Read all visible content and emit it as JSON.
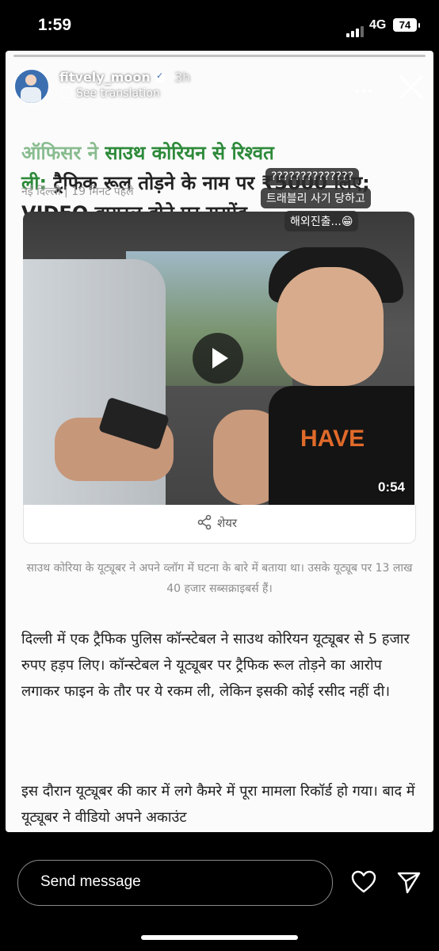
{
  "status_bar": {
    "time": "1:59",
    "network": "4G",
    "battery": "74"
  },
  "story": {
    "username": "fitvely_moon",
    "time_ago": "3h",
    "translate_label": "See translation",
    "sticker_lines": [
      "??????????????",
      "트래블리 사기 당하고",
      "해외진출...😁"
    ]
  },
  "article": {
    "headline_overlap": "ऑफिसर ने",
    "headline_line1": "साउथ कोरियन से रिश्वत",
    "headline_line2_green": "ली:",
    "headline_line2": " ट्रैफिक रूल तोड़ने के नाम पर ₹5000 लिए;",
    "headline_line3": "VIDEO वायरल होने पर सस्पेंड",
    "location": "नई दिल्ली",
    "published": "19 मिनट पहले",
    "video_duration": "0:54",
    "share_label": "शेयर",
    "caption": "साउथ कोरिया के यूट्यूबर ने अपने व्लॉग में घटना के बारे में बताया था। उसके यूट्यूब पर 13 लाख 40 हजार सब्सक्राइबर्स हैं।",
    "paragraph1": "दिल्ली में एक ट्रैफिक पुलिस कॉन्स्टेबल ने साउथ कोरियन यूट्यूबर से 5 हजार रुपए हड़प लिए। कॉन्स्टेबल ने यूट्यूबर पर ट्रैफिक रूल तोड़ने का आरोप लगाकर फाइन के तौर पर ये रकम ली, लेकिन इसकी कोई रसीद नहीं दी।",
    "paragraph2": "इस दौरान यूट्यूबर की कार में लगे कैमरे में पूरा मामला रिकॉर्ड हो गया। बाद में यूट्यूबर ने वीडियो अपने अकाउंट"
  },
  "bottom_bar": {
    "message_placeholder": "Send message"
  },
  "icons": {
    "like": "heart-icon",
    "send": "paper-plane-icon",
    "close": "close-icon",
    "more": "more-icon",
    "share": "share-icon",
    "play": "play-icon"
  }
}
